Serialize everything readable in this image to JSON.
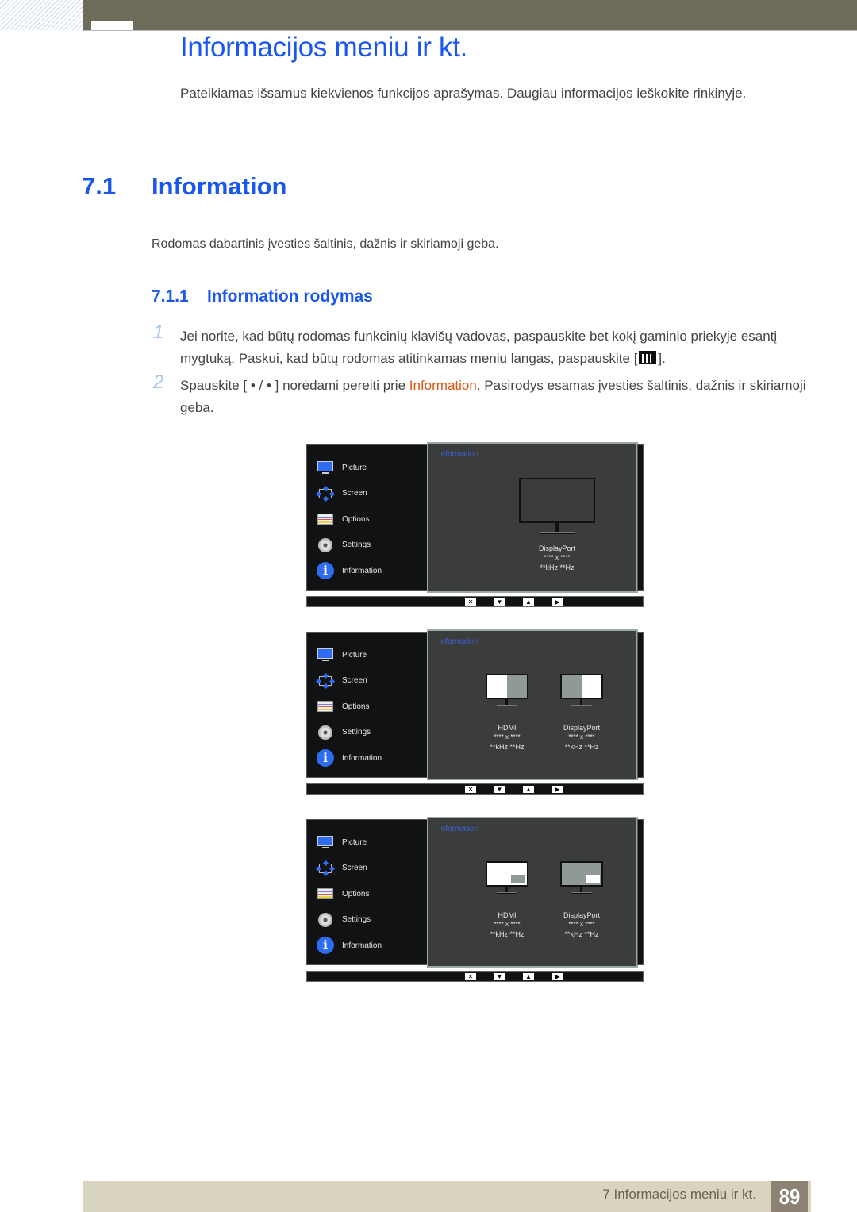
{
  "chapter": {
    "title": "Informacijos meniu ir kt.",
    "intro": "Pateikiamas išsamus kiekvienos funkcijos aprašymas. Daugiau informacijos ieškokite rinkinyje."
  },
  "section": {
    "number": "7.1",
    "title": "Information",
    "description": "Rodomas dabartinis įvesties šaltinis, dažnis ir skiriamoji geba."
  },
  "subsection": {
    "number": "7.1.1",
    "title": "Information rodymas"
  },
  "steps": [
    {
      "number": "1",
      "text_before": "Jei norite, kad būtų rodomas funkcinių klavišų vadovas, paspauskite bet kokį gaminio priekyje esantį mygtuką. Paskui, kad būtų rodomas atitinkamas meniu langas, paspauskite [",
      "icon": "menu-key-icon",
      "text_after": "]."
    },
    {
      "number": "2",
      "text_before": "Spauskite [ • / • ] norėdami pereiti prie ",
      "highlight": "Information",
      "text_after": ". Pasirodys esamas įvesties šaltinis, dažnis ir skiriamoji geba."
    }
  ],
  "osd": {
    "menu_items": [
      {
        "label": "Picture",
        "icon": "picture-icon"
      },
      {
        "label": "Screen",
        "icon": "screen-icon"
      },
      {
        "label": "Options",
        "icon": "options-icon"
      },
      {
        "label": "Settings",
        "icon": "settings-icon"
      },
      {
        "label": "Information",
        "icon": "info-icon"
      }
    ],
    "heading": "Information",
    "buttons": [
      "✕",
      "▼",
      "▲",
      "▶"
    ],
    "panels": [
      {
        "sources": [
          {
            "name": "DisplayPort",
            "resolution": "**** x ****",
            "frequency": "**kHz **Hz",
            "screen": "single"
          }
        ]
      },
      {
        "sources": [
          {
            "name": "HDMI",
            "resolution": "**** x ****",
            "frequency": "**kHz **Hz",
            "screen": "pbp-left"
          },
          {
            "name": "DisplayPort",
            "resolution": "**** x ****",
            "frequency": "**kHz **Hz",
            "screen": "pbp-right"
          }
        ]
      },
      {
        "sources": [
          {
            "name": "HDMI",
            "resolution": "**** x ****",
            "frequency": "**kHz **Hz",
            "screen": "pip-main"
          },
          {
            "name": "DisplayPort",
            "resolution": "**** x ****",
            "frequency": "**kHz **Hz",
            "screen": "pip-sub"
          }
        ]
      }
    ]
  },
  "footer": {
    "chapter_label": "7 Informacijos meniu ir kt.",
    "page_number": "89"
  }
}
